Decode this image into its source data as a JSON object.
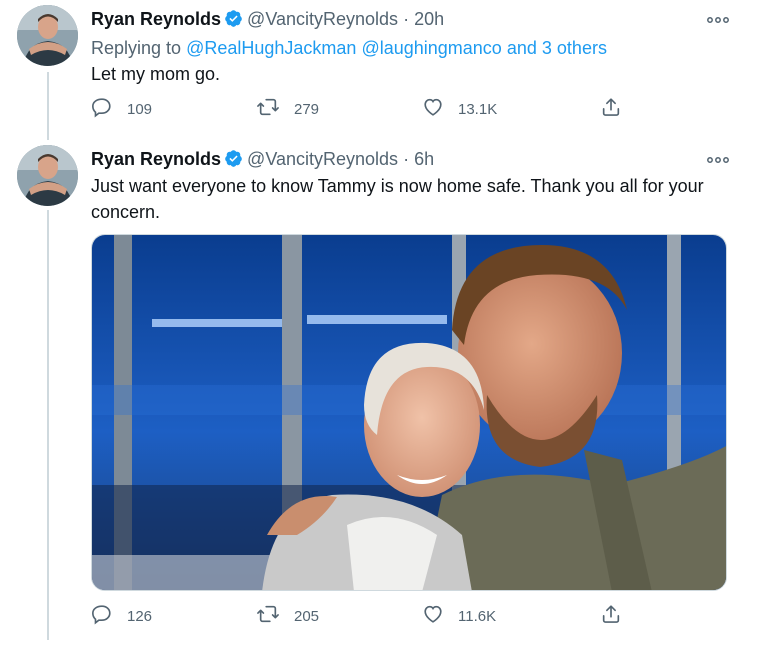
{
  "tweets": [
    {
      "name": "Ryan Reynolds",
      "handle": "@VancityReynolds",
      "dot": "·",
      "time": "20h",
      "replying": {
        "prefix": "Replying to",
        "mention1": "@RealHughJackman",
        "mention2": "@laughingmanco",
        "connector": "and",
        "others": "3 others"
      },
      "text": "Let my mom go.",
      "replies": "109",
      "retweets": "279",
      "likes": "13.1K"
    },
    {
      "name": "Ryan Reynolds",
      "handle": "@VancityReynolds",
      "dot": "·",
      "time": "6h",
      "text": "Just want everyone to know Tammy is now home safe. Thank you all for your concern.",
      "replies": "126",
      "retweets": "205",
      "likes": "11.6K"
    }
  ],
  "icons": {
    "more": "more-options-icon",
    "reply": "reply-icon",
    "retweet": "retweet-icon",
    "like": "heart-icon",
    "share": "share-icon",
    "verified": "verified-badge-icon"
  },
  "colors": {
    "accent": "#1d9bf0",
    "secondary_text": "#536471",
    "primary_text": "#0f1419",
    "thread_line": "#cfd9de"
  }
}
